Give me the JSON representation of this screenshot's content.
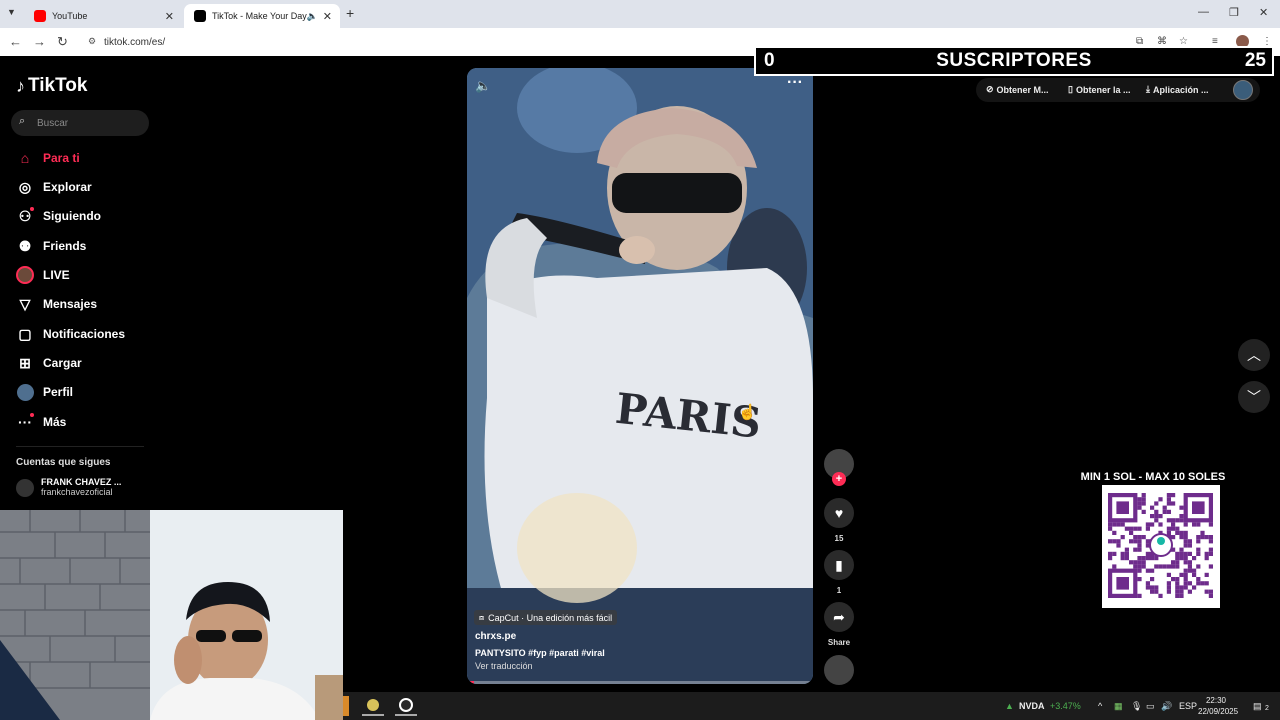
{
  "browser": {
    "tabs": [
      {
        "title": "YouTube",
        "active": false
      },
      {
        "title": "TikTok - Make Your Day",
        "active": true
      }
    ],
    "url": "tiktok.com/es/"
  },
  "stream_overlay": {
    "subscribers_current": "0",
    "subscribers_label": "SUSCRIPTORES",
    "subscribers_goal": "25",
    "donation_text": "MIN 1 SOL - MAX 10 SOLES",
    "qr_brand": "yape",
    "qr_accent": "#6e2c8c"
  },
  "tiktok": {
    "brand": "TikTok",
    "search_placeholder": "Buscar",
    "nav": [
      {
        "label": "Para ti",
        "icon": "home-icon",
        "active": true
      },
      {
        "label": "Explorar",
        "icon": "compass-icon"
      },
      {
        "label": "Siguiendo",
        "icon": "following-icon"
      },
      {
        "label": "Friends",
        "icon": "friends-icon"
      },
      {
        "label": "LIVE",
        "icon": "live-icon"
      },
      {
        "label": "Mensajes",
        "icon": "messages-icon"
      },
      {
        "label": "Notificaciones",
        "icon": "notifications-icon"
      },
      {
        "label": "Cargar",
        "icon": "upload-icon"
      },
      {
        "label": "Perfil",
        "icon": "profile-icon"
      },
      {
        "label": "Más",
        "icon": "more-icon"
      }
    ],
    "following_title": "Cuentas que sigues",
    "following_accounts": [
      {
        "name": "FRANK CHAVEZ ...",
        "handle": "frankchavezoficial"
      }
    ],
    "header_links": [
      "Obtener M...",
      "Obtener la ...",
      "Aplicación ..."
    ],
    "accent_color": "#fe2c55",
    "video": {
      "effect_label": "CapCut · Una edición más fácil",
      "author": "chrxs.pe",
      "caption": "PANTYSITO #fyp  #parati  #viral",
      "translate": "Ver traducción",
      "progress": 0.02,
      "actions": {
        "likes": "15",
        "saves": "1",
        "share": "Share"
      }
    }
  },
  "taskbar": {
    "stock_ticker": "NVDA",
    "stock_change": "+3.47%",
    "language": "ESP",
    "time": "22:30",
    "date": "22/09/2025",
    "notifications": "2"
  }
}
